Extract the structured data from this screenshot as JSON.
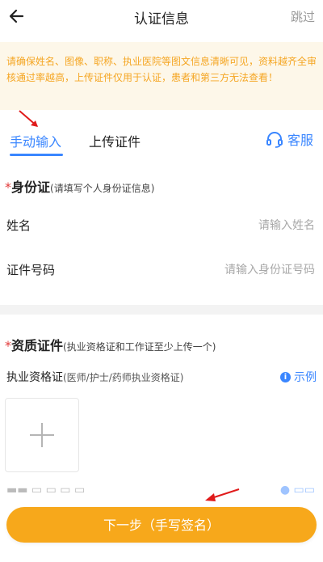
{
  "navbar": {
    "title": "认证信息",
    "skip_label": "跳过",
    "back_icon": "back-arrow-icon"
  },
  "notice": {
    "text": "请确保姓名、图像、职称、执业医院等图文信息清晰可见，资料越齐全审核通过率越高，上传证件仅用于认证，患者和第三方无法查看！"
  },
  "tabs": {
    "manual_label": "手动输入",
    "upload_label": "上传证件",
    "service_label": "客服",
    "service_icon": "headset-icon"
  },
  "id_section": {
    "title": "身份证",
    "hint": "(请填写个人身份证信息)",
    "name_label": "姓名",
    "name_placeholder": "请输入姓名",
    "id_label": "证件号码",
    "id_placeholder": "请输入身份证号码"
  },
  "qual_section": {
    "title": "资质证件",
    "hint": "(执业资格证和工作证至少上传一个)",
    "license_label": "执业资格证",
    "license_sub": "(医师/护士/药师执业资格证)",
    "example_label": "示例"
  },
  "footer": {
    "next_label": "下一步（手写签名）"
  },
  "colors": {
    "accent_blue": "#3a86ff",
    "warning_orange": "#f5a623",
    "button_orange": "#f7a81b",
    "required_red": "#e23b3b"
  }
}
